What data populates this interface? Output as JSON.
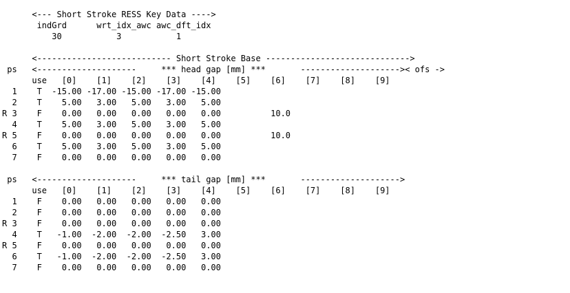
{
  "lines": [
    {
      "name": "key-data-header",
      "text": "      <--- Short Stroke RESS Key Data ---->"
    },
    {
      "name": "key-data-labels",
      "text": "       indGrd      wrt_idx_awc awc_dft_idx"
    },
    {
      "name": "key-data-values",
      "text": "          30           3           1"
    },
    {
      "name": "blank-line",
      "text": ""
    },
    {
      "name": "base-header",
      "text": "      <--------------------------- Short Stroke Base ----------------------------->"
    },
    {
      "name": "head-gap-header",
      "text": " ps   <--------------------     *** head gap [mm] ***       -------------------->< ofs ->"
    },
    {
      "name": "head-col-header",
      "text": "      use   [0]    [1]    [2]    [3]    [4]    [5]    [6]    [7]    [8]    [9]"
    },
    {
      "name": "head-row-1",
      "text": "  1    T  -15.00 -17.00 -15.00 -17.00 -15.00"
    },
    {
      "name": "head-row-2",
      "text": "  2    T    5.00   3.00   5.00   3.00   5.00"
    },
    {
      "name": "head-row-3",
      "text": "R 3    F    0.00   0.00   0.00   0.00   0.00          10.0"
    },
    {
      "name": "head-row-4",
      "text": "  4    T    5.00   3.00   5.00   3.00   5.00"
    },
    {
      "name": "head-row-5",
      "text": "R 5    F    0.00   0.00   0.00   0.00   0.00          10.0"
    },
    {
      "name": "head-row-6",
      "text": "  6    T    5.00   3.00   5.00   3.00   5.00"
    },
    {
      "name": "head-row-7",
      "text": "  7    F    0.00   0.00   0.00   0.00   0.00"
    },
    {
      "name": "blank-line",
      "text": ""
    },
    {
      "name": "tail-gap-header",
      "text": " ps   <--------------------     *** tail gap [mm] ***       -------------------->"
    },
    {
      "name": "tail-col-header",
      "text": "      use   [0]    [1]    [2]    [3]    [4]    [5]    [6]    [7]    [8]    [9]"
    },
    {
      "name": "tail-row-1",
      "text": "  1    F    0.00   0.00   0.00   0.00   0.00"
    },
    {
      "name": "tail-row-2",
      "text": "  2    F    0.00   0.00   0.00   0.00   0.00"
    },
    {
      "name": "tail-row-3",
      "text": "R 3    F    0.00   0.00   0.00   0.00   0.00"
    },
    {
      "name": "tail-row-4",
      "text": "  4    T   -1.00  -2.00  -2.00  -2.50   3.00"
    },
    {
      "name": "tail-row-5",
      "text": "R 5    F    0.00   0.00   0.00   0.00   0.00"
    },
    {
      "name": "tail-row-6",
      "text": "  6    T   -1.00  -2.00  -2.00  -2.50   3.00"
    },
    {
      "name": "tail-row-7",
      "text": "  7    F    0.00   0.00   0.00   0.00   0.00"
    }
  ]
}
